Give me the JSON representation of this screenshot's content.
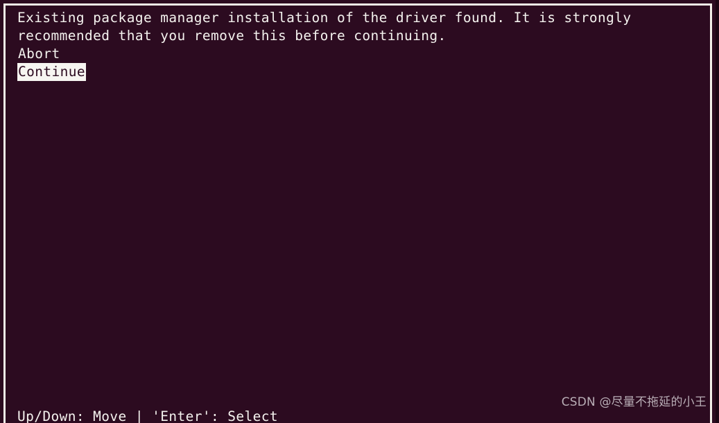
{
  "terminal": {
    "background_color": "#2c0b20",
    "foreground_color": "#f4f2ee",
    "border_color": "#f2efe8"
  },
  "dialog": {
    "message_lines": [
      "Existing package manager installation of the driver found. It is strongly",
      "recommended that you remove this before continuing."
    ],
    "menu": {
      "items": [
        {
          "label": "Abort",
          "selected": false
        },
        {
          "label": "Continue",
          "selected": true
        }
      ],
      "selected_index": 1,
      "selection_bg": "#f7f5f1",
      "selection_fg": "#2c0b20"
    }
  },
  "footer": {
    "hint": "Up/Down: Move | 'Enter': Select"
  },
  "watermark": {
    "text": "CSDN @尽量不拖延的小王",
    "color": "#b9aeb6"
  }
}
